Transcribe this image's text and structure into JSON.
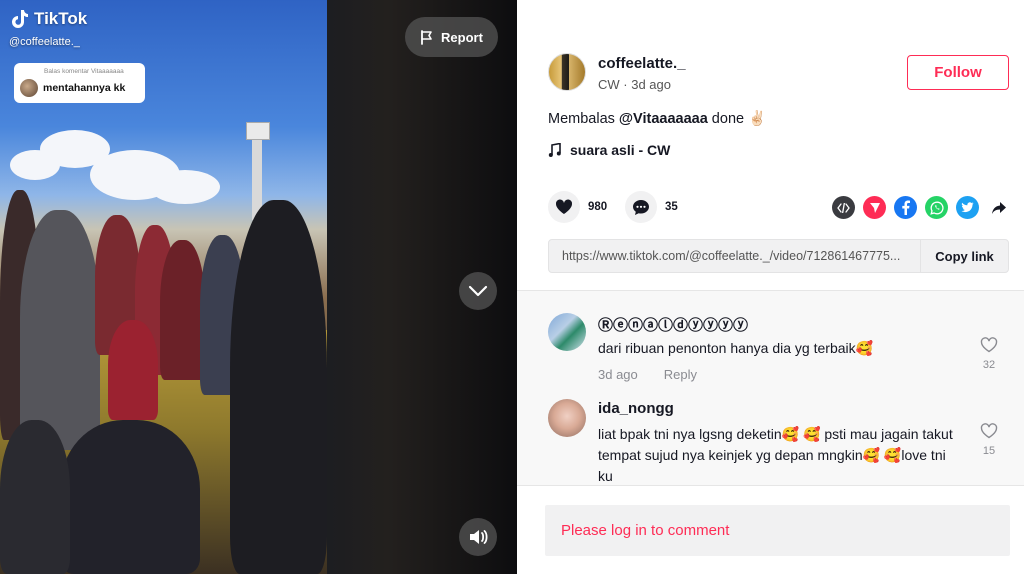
{
  "video": {
    "logo_text": "TikTok",
    "handle": "@coffeelatte._",
    "reply_bubble": {
      "small_text": "Balas komentar Vitaaaaaaa",
      "text": "mentahannya kk"
    },
    "report_label": "Report",
    "icons": [
      "tiktok-logo-icon",
      "flag-icon",
      "chevron-down-icon",
      "volume-icon"
    ]
  },
  "author": {
    "name": "coffeelatte._",
    "nickname": "CW",
    "time": "3d ago",
    "meta": "CW · 3d ago",
    "follow_label": "Follow"
  },
  "caption": {
    "prefix": "Membalas ",
    "mention": "@Vitaaaaaaa",
    "suffix": " done ✌🏻"
  },
  "music": {
    "label": "suara asli - CW"
  },
  "stats": {
    "likes": "980",
    "comments": "35"
  },
  "share_icons": [
    "embed-icon",
    "send-icon",
    "facebook-icon",
    "whatsapp-icon",
    "twitter-icon",
    "share-arrow-icon"
  ],
  "link": {
    "url": "https://www.tiktok.com/@coffeelatte._/video/712861467775...",
    "copy_label": "Copy link"
  },
  "comments": [
    {
      "name": "Ⓡⓔⓝⓐⓛⓓⓨⓨⓨⓨ",
      "text": "dari ribuan penonton hanya dia yg terbaik🥰",
      "time": "3d ago",
      "reply_label": "Reply",
      "likes": "32"
    },
    {
      "name": "ida_nongg",
      "text": "liat bpak tni nya lgsng deketin🥰 🥰  psti mau jagain takut tempat sujud nya keinjek yg depan mngkin🥰 🥰love tni ku",
      "likes": "15"
    }
  ],
  "login_prompt": "Please log in to comment",
  "colors": {
    "brand": "#fe2c55",
    "text": "#161823",
    "muted": "#8a8b91",
    "facebook": "#1877f2",
    "whatsapp": "#25d366",
    "twitter": "#1da1f2",
    "send": "#fe2c55"
  }
}
